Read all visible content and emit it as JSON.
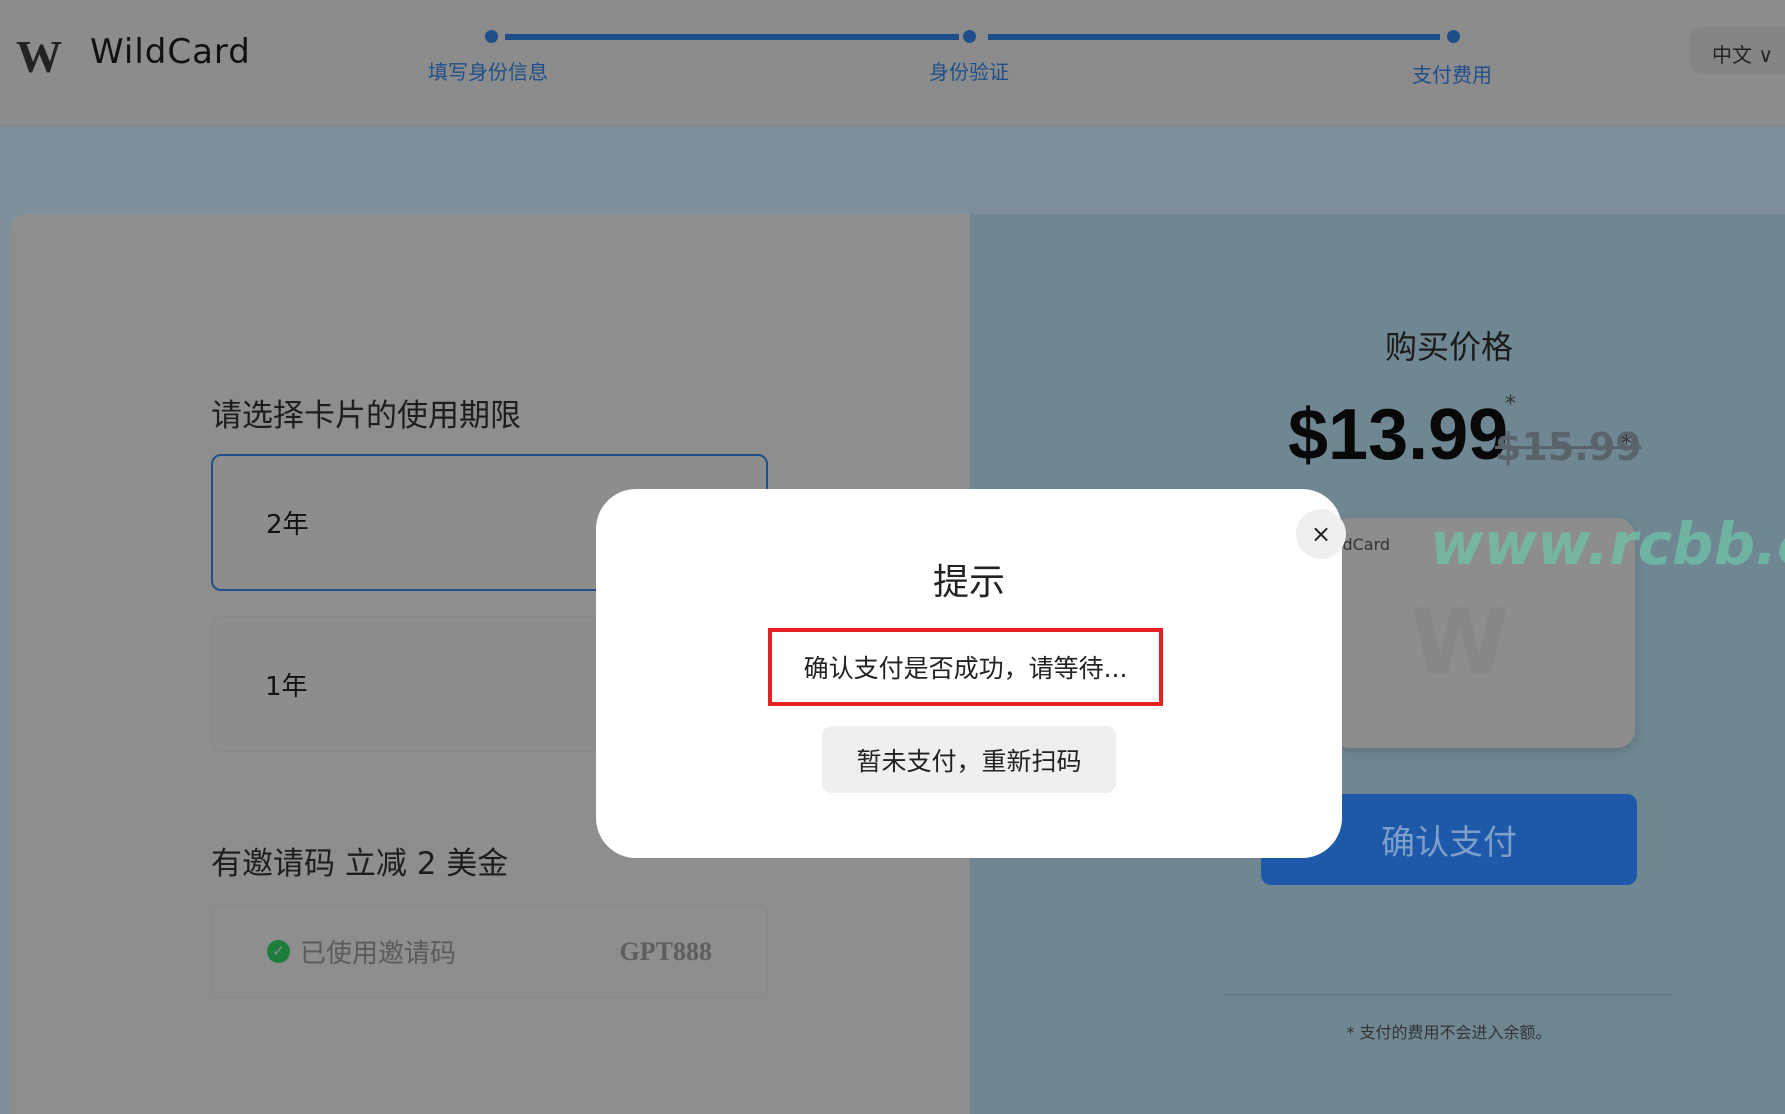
{
  "header": {
    "logo": "W",
    "brand": "WildCard",
    "steps": [
      "填写身份信息",
      "身份验证",
      "支付费用"
    ],
    "language": "中文",
    "lang_chevron": "∨"
  },
  "left": {
    "period_title": "请选择卡片的使用期限",
    "options": [
      "2年",
      "1年"
    ],
    "selected": "2年",
    "invite_title": "有邀请码 立减 2 美金",
    "invite_status": "已使用邀请码",
    "invite_code": "GPT888"
  },
  "right": {
    "price_title": "购买价格",
    "price": "$13.99",
    "old_price": "$15.99",
    "star": "*",
    "card_brand": "ldCard",
    "card_logo": "W",
    "pay_button": "确认支付",
    "footnote": "* 支付的费用不会进入余额。"
  },
  "watermark": "www.rcbb.cc",
  "modal": {
    "title": "提示",
    "message": "确认支付是否成功，请等待...",
    "rescan_button": "暂未支付，重新扫码",
    "close": "×"
  },
  "colors": {
    "accent": "#1f4f8a",
    "highlight_border": "#e52222",
    "success": "#1e7d3c"
  }
}
